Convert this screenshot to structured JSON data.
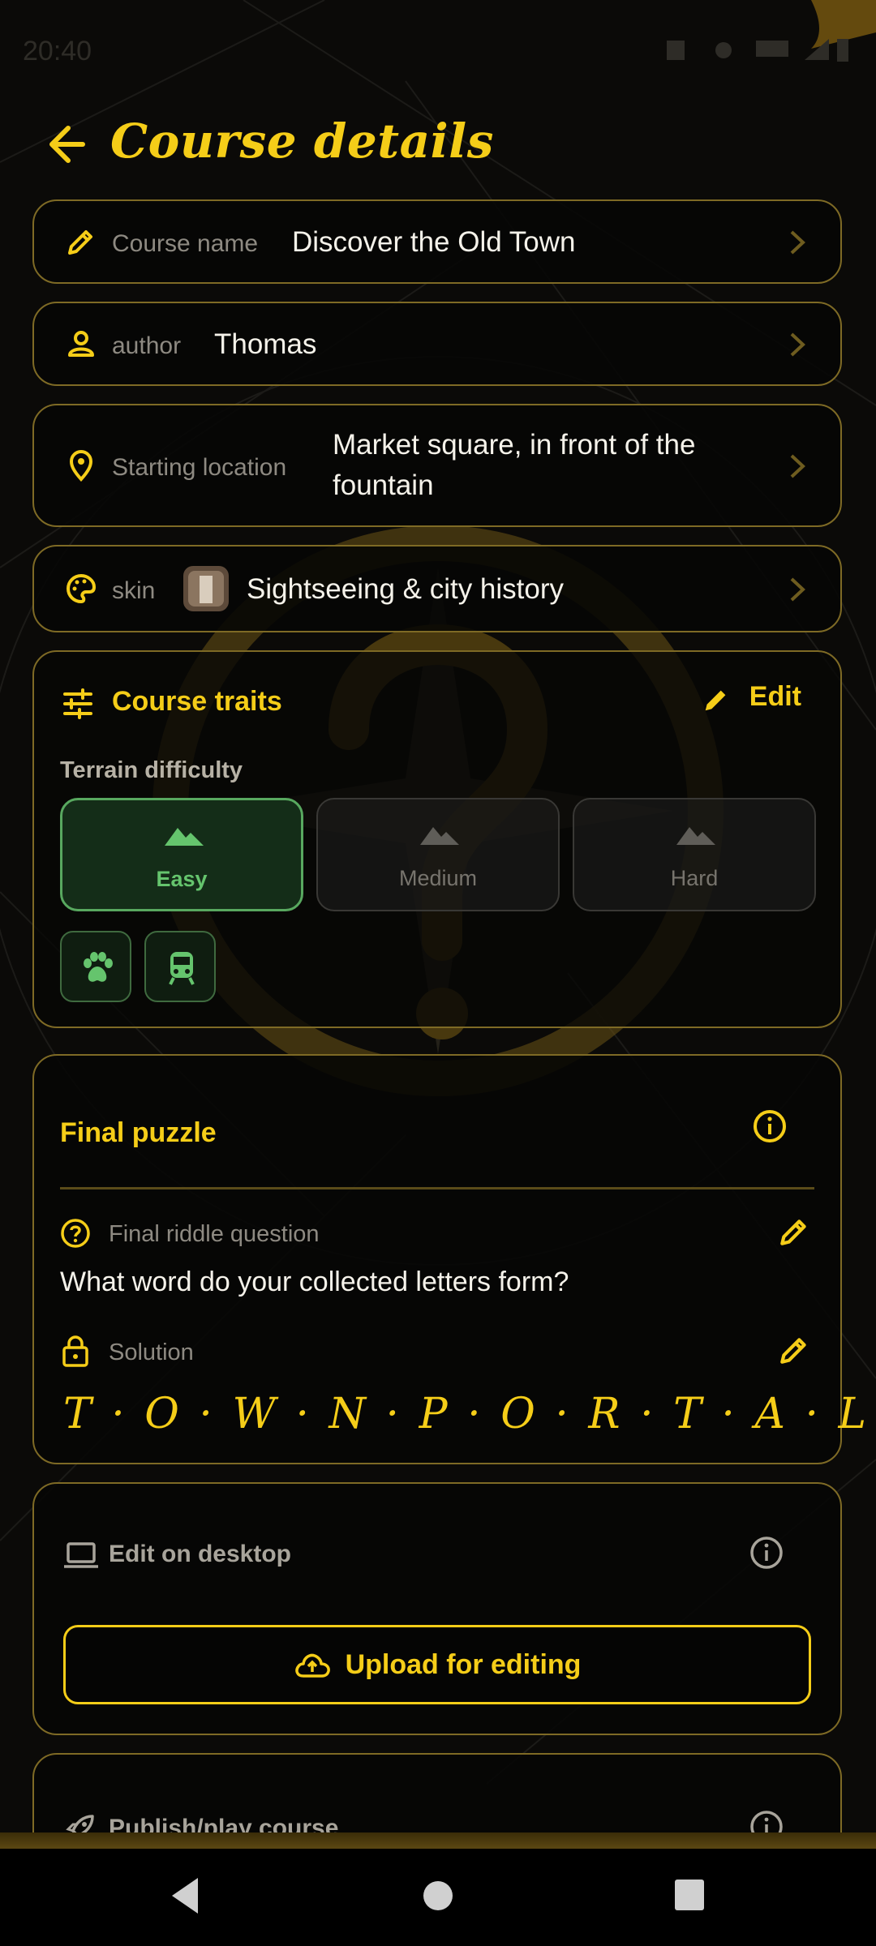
{
  "status_bar": {
    "time": "20:40"
  },
  "header": {
    "back_icon": "arrow-left-icon",
    "title": "Course details"
  },
  "rows": {
    "course_name": {
      "icon": "pencil-icon",
      "label": "Course name",
      "value": "Discover the Old Town"
    },
    "author": {
      "icon": "person-icon",
      "label": "author",
      "value": "Thomas"
    },
    "starting_location": {
      "icon": "location-pin-icon",
      "label": "Starting location",
      "value_line1": "Market square, in front of the",
      "value_line2": "fountain"
    },
    "skin": {
      "icon": "palette-icon",
      "label": "skin",
      "value": "Sightseeing & city history"
    }
  },
  "traits": {
    "title": "Course traits",
    "edit_label": "Edit",
    "terrain_label": "Terrain difficulty",
    "difficulties": [
      {
        "label": "Easy",
        "selected": true
      },
      {
        "label": "Medium",
        "selected": false
      },
      {
        "label": "Hard",
        "selected": false
      }
    ],
    "chips": [
      "paw-icon",
      "train-icon"
    ]
  },
  "final_puzzle": {
    "title": "Final puzzle",
    "question_label": "Final riddle question",
    "question": "What word do your collected letters form?",
    "solution_label": "Solution",
    "solution": "T · O · W · N · P · O · R · T · A · L"
  },
  "desktop": {
    "title": "Edit on desktop",
    "button_label": "Upload for editing"
  },
  "publish": {
    "title": "Publish/play course"
  },
  "colors": {
    "accent": "#f5cd18",
    "success": "#58a85f",
    "background": "#0b0a08",
    "border": "#7e6a25"
  }
}
